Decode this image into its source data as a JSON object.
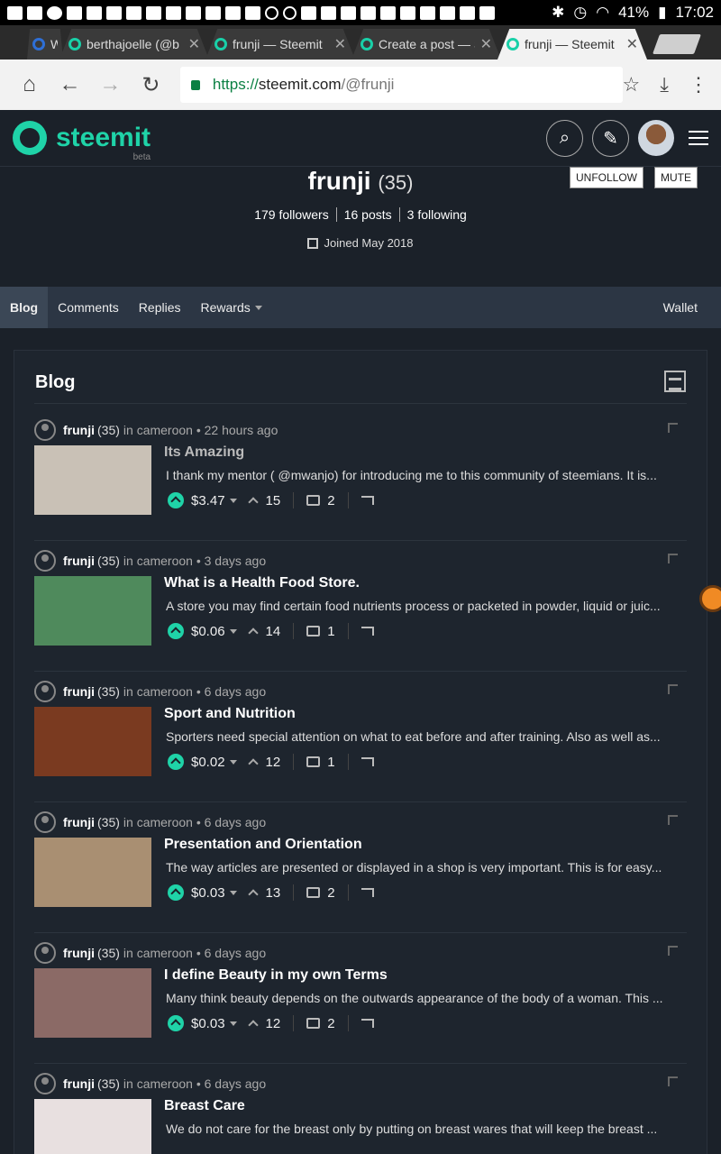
{
  "statusbar": {
    "battery": "41%",
    "time": "17:02"
  },
  "tabs": [
    {
      "label": "W",
      "active": false
    },
    {
      "label": "berthajoelle (@b",
      "active": false
    },
    {
      "label": "frunji — Steemit",
      "active": false
    },
    {
      "label": "Create a post — S",
      "active": false
    },
    {
      "label": "frunji — Steemit",
      "active": true
    }
  ],
  "urlbar": {
    "https": "https://",
    "host": "steemit.com",
    "path": "/@frunji"
  },
  "header": {
    "brand": "steemit",
    "beta": "beta"
  },
  "profile": {
    "name": "frunji",
    "reputation": "(35)",
    "unfollow": "UNFOLLOW",
    "mute": "MUTE",
    "followers": "179 followers",
    "posts": "16 posts",
    "following": "3 following",
    "joined": "Joined May 2018"
  },
  "subnav": {
    "blog": "Blog",
    "comments": "Comments",
    "replies": "Replies",
    "rewards": "Rewards",
    "wallet": "Wallet"
  },
  "blog": {
    "title": "Blog",
    "posts": [
      {
        "author": "frunji",
        "rep": "(35)",
        "meta": "in cameroon • 22 hours ago",
        "title": "Its Amazing",
        "body": "I thank my mentor ( @mwanjo) for introducing me to this community of steemians. It is...",
        "payout": "$3.47",
        "votes": "15",
        "comments": "2",
        "thumb_color": "#c9c1b6"
      },
      {
        "author": "frunji",
        "rep": "(35)",
        "meta": "in cameroon • 3 days ago",
        "title": "What is a Health Food Store.",
        "body": "A store you may find certain food nutrients process or packeted in powder, liquid or juic...",
        "payout": "$0.06",
        "votes": "14",
        "comments": "1",
        "thumb_color": "#4f8a5c"
      },
      {
        "author": "frunji",
        "rep": "(35)",
        "meta": "in cameroon • 6 days ago",
        "title": "Sport and Nutrition",
        "body": "Sporters need special attention on what to eat before and after training. Also as well as...",
        "payout": "$0.02",
        "votes": "12",
        "comments": "1",
        "thumb_color": "#7a3a20"
      },
      {
        "author": "frunji",
        "rep": "(35)",
        "meta": "in cameroon • 6 days ago",
        "title": "Presentation and Orientation",
        "body": "The way articles are presented or displayed in a shop is very important. This is for easy...",
        "payout": "$0.03",
        "votes": "13",
        "comments": "2",
        "thumb_color": "#a98f72"
      },
      {
        "author": "frunji",
        "rep": "(35)",
        "meta": "in cameroon • 6 days ago",
        "title": "I define Beauty in my own Terms",
        "body": "Many think beauty depends on the outwards appearance of the body of a woman. This ...",
        "payout": "$0.03",
        "votes": "12",
        "comments": "2",
        "thumb_color": "#8b6a66"
      },
      {
        "author": "frunji",
        "rep": "(35)",
        "meta": "in cameroon • 6 days ago",
        "title": "Breast Care",
        "body": "We do not care for the breast only by putting on breast wares that will keep the breast ...",
        "payout": "",
        "votes": "",
        "comments": "",
        "thumb_color": "#e8e0e0"
      }
    ]
  }
}
